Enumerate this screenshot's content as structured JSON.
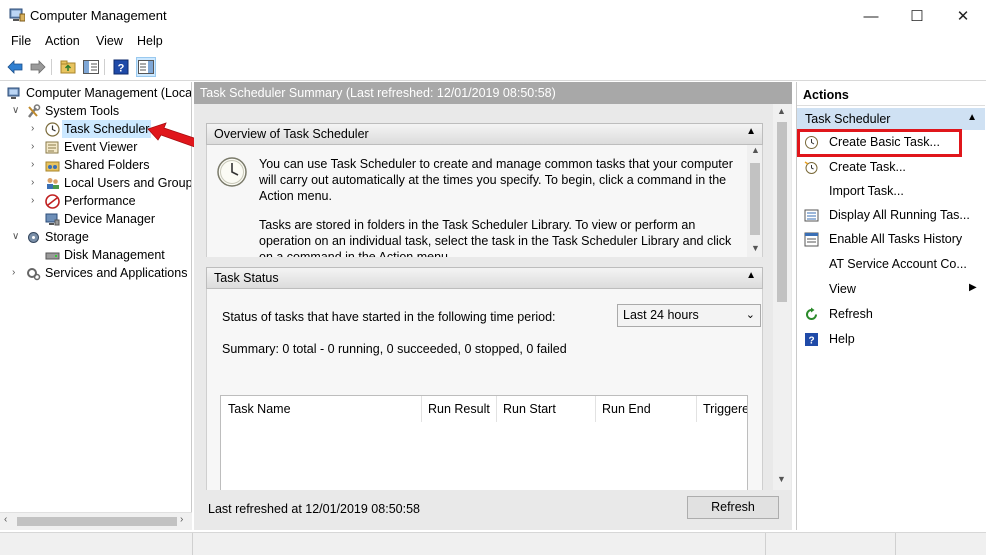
{
  "window": {
    "title": "Computer Management",
    "controls": [
      "—",
      "☐",
      "✕"
    ]
  },
  "menu": [
    "File",
    "Action",
    "View",
    "Help"
  ],
  "tree": {
    "items": [
      {
        "label": "Computer Management (Local",
        "expanded": true
      },
      {
        "label": "System Tools",
        "expanded": true
      },
      {
        "label": "Task Scheduler",
        "selected": true
      },
      {
        "label": "Event Viewer"
      },
      {
        "label": "Shared Folders"
      },
      {
        "label": "Local Users and Groups"
      },
      {
        "label": "Performance"
      },
      {
        "label": "Device Manager"
      },
      {
        "label": "Storage",
        "expanded": true
      },
      {
        "label": "Disk Management"
      },
      {
        "label": "Services and Applications"
      }
    ]
  },
  "center": {
    "header": "Task Scheduler Summary (Last refreshed: 12/01/2019 08:50:58)",
    "overview": {
      "title": "Overview of Task Scheduler",
      "para1": "You can use Task Scheduler to create and manage common tasks that your computer will carry out automatically at the times you specify. To begin, click a command in the Action menu.",
      "para2": "Tasks are stored in folders in the Task Scheduler Library. To view or perform an operation on an individual task, select the task in the Task Scheduler Library and click on a command in the Action menu."
    },
    "status": {
      "title": "Task Status",
      "period_label": "Status of tasks that have started in the following time period:",
      "period_value": "Last 24 hours",
      "summary": "Summary: 0 total - 0 running, 0 succeeded, 0 stopped, 0 failed",
      "columns": [
        "Task Name",
        "Run Result",
        "Run Start",
        "Run End",
        "Triggered B"
      ]
    },
    "footer": {
      "refreshed": "Last refreshed at 12/01/2019 08:50:58",
      "refresh_button": "Refresh"
    }
  },
  "actions": {
    "header": "Actions",
    "group": "Task Scheduler",
    "items": [
      {
        "label": "Create Basic Task...",
        "icon": "create-basic-task-icon"
      },
      {
        "label": "Create Task...",
        "icon": "create-task-icon"
      },
      {
        "label": "Import Task...",
        "icon": ""
      },
      {
        "label": "Display All Running Tas...",
        "icon": "running-tasks-icon"
      },
      {
        "label": "Enable All Tasks History",
        "icon": "history-icon"
      },
      {
        "label": "AT Service Account Co...",
        "icon": ""
      },
      {
        "label": "View",
        "icon": "",
        "submenu": true
      },
      {
        "label": "Refresh",
        "icon": "refresh-icon"
      },
      {
        "label": "Help",
        "icon": "help-icon"
      }
    ]
  },
  "colors": {
    "highlight": "#e0161b",
    "arrow": "#e0161b",
    "selection": "#cce8ff",
    "group": "#cfe1f3"
  }
}
